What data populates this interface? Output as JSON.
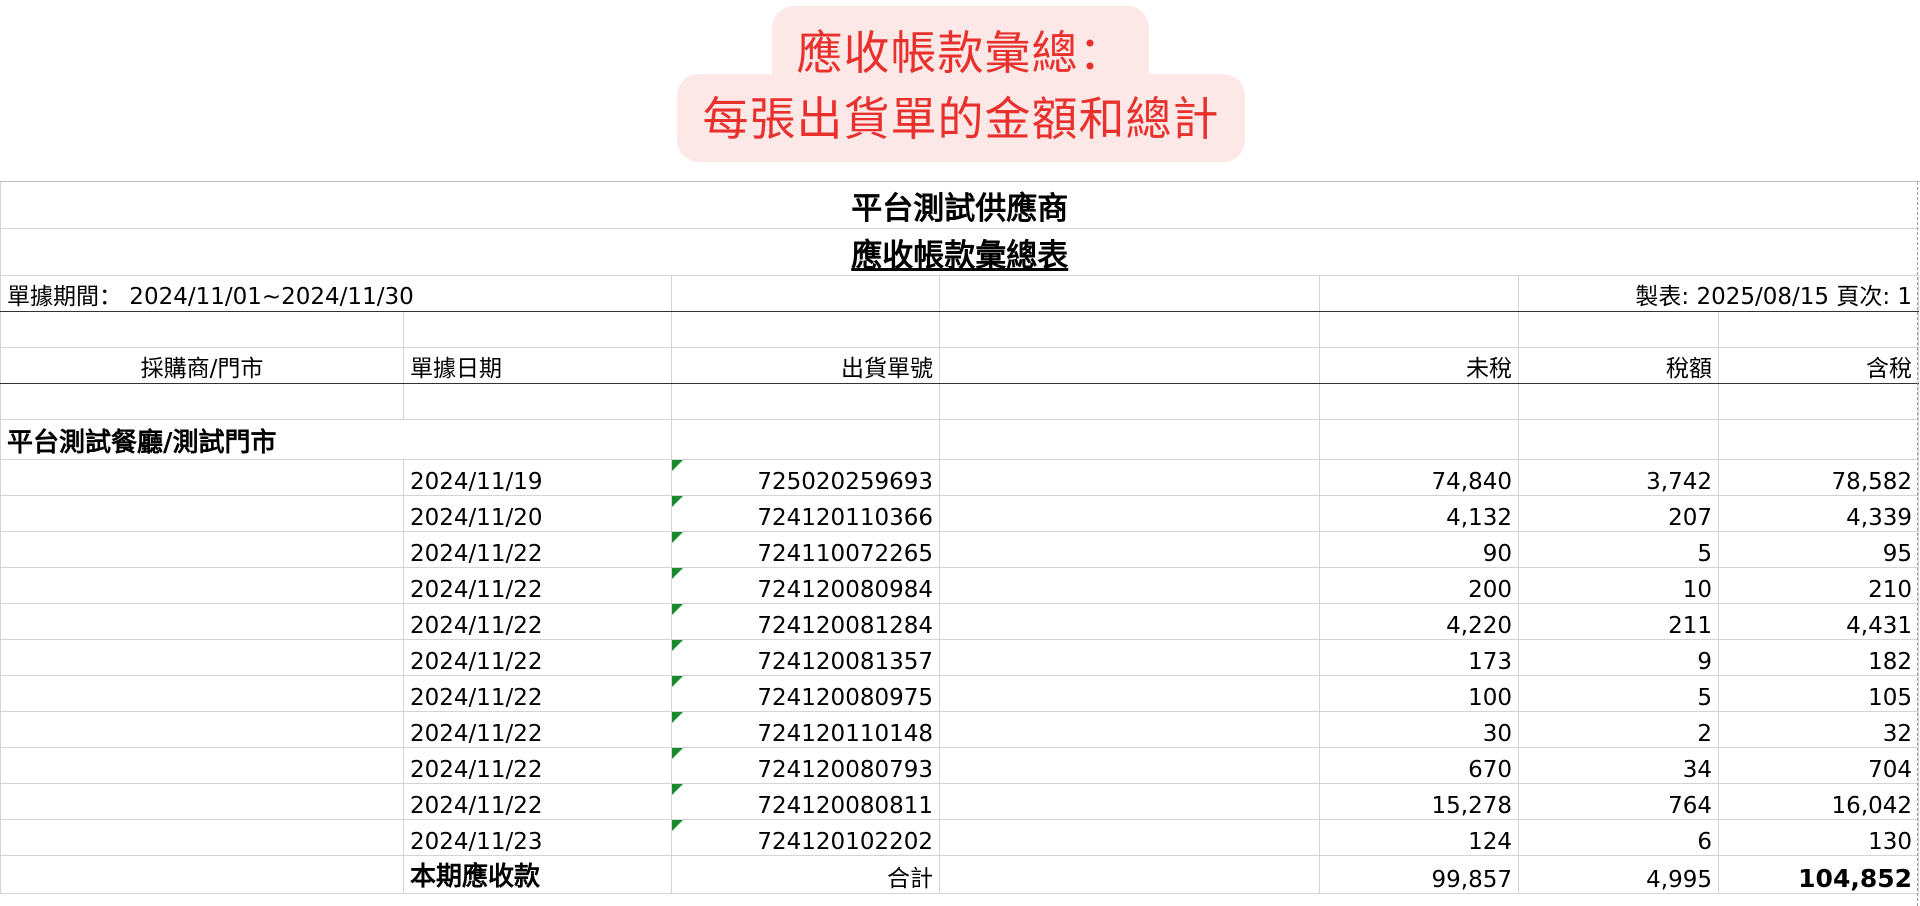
{
  "callout": {
    "line1": "應收帳款彙總：",
    "line2": "每張出貨單的金額和總計"
  },
  "report": {
    "company": "平台測試供應商",
    "title": "應收帳款彙總表",
    "period": "單據期間： 2024/11/01~2024/11/30",
    "made": "製表: 2025/08/15 頁次: 1"
  },
  "columns": {
    "customer": "採購商/門市",
    "date": "單據日期",
    "order": "出貨單號",
    "pretax": "未稅",
    "tax": "稅額",
    "total": "含稅"
  },
  "group": {
    "name": "平台測試餐廳/測試門市"
  },
  "rows": [
    {
      "date": "2024/11/19",
      "order": "725020259693",
      "pretax": "74,840",
      "tax": "3,742",
      "total": "78,582"
    },
    {
      "date": "2024/11/20",
      "order": "724120110366",
      "pretax": "4,132",
      "tax": "207",
      "total": "4,339"
    },
    {
      "date": "2024/11/22",
      "order": "724110072265",
      "pretax": "90",
      "tax": "5",
      "total": "95"
    },
    {
      "date": "2024/11/22",
      "order": "724120080984",
      "pretax": "200",
      "tax": "10",
      "total": "210"
    },
    {
      "date": "2024/11/22",
      "order": "724120081284",
      "pretax": "4,220",
      "tax": "211",
      "total": "4,431"
    },
    {
      "date": "2024/11/22",
      "order": "724120081357",
      "pretax": "173",
      "tax": "9",
      "total": "182"
    },
    {
      "date": "2024/11/22",
      "order": "724120080975",
      "pretax": "100",
      "tax": "5",
      "total": "105"
    },
    {
      "date": "2024/11/22",
      "order": "724120110148",
      "pretax": "30",
      "tax": "2",
      "total": "32"
    },
    {
      "date": "2024/11/22",
      "order": "724120080793",
      "pretax": "670",
      "tax": "34",
      "total": "704"
    },
    {
      "date": "2024/11/22",
      "order": "724120080811",
      "pretax": "15,278",
      "tax": "764",
      "total": "16,042"
    },
    {
      "date": "2024/11/23",
      "order": "724120102202",
      "pretax": "124",
      "tax": "6",
      "total": "130"
    }
  ],
  "totals": {
    "label": "本期應收款",
    "sum_label": "合計",
    "pretax": "99,857",
    "tax": "4,995",
    "total": "104,852"
  },
  "colors": {
    "callout_bg": "#fde8e8",
    "callout_text": "#e8302c",
    "text_marker": "#1b8a2c"
  }
}
